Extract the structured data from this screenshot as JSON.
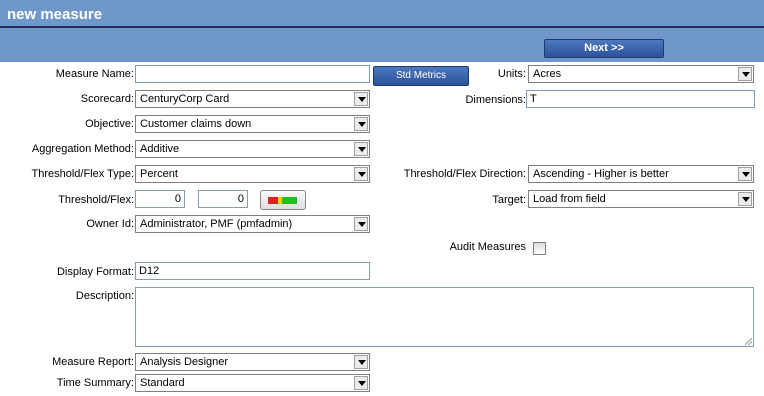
{
  "header": {
    "title": "new measure"
  },
  "toolbar": {
    "next_label": "Next >>"
  },
  "form": {
    "measure_name": {
      "label": "Measure Name:",
      "value": ""
    },
    "std_metrics_label": "Std Metrics",
    "units": {
      "label": "Units:",
      "value": "Acres"
    },
    "scorecard": {
      "label": "Scorecard:",
      "value": "CenturyCorp Card"
    },
    "dimensions": {
      "label": "Dimensions:",
      "value": "T"
    },
    "objective": {
      "label": "Objective:",
      "value": "Customer claims down"
    },
    "aggregation_method": {
      "label": "Aggregation Method:",
      "value": "Additive"
    },
    "threshold_flex_type": {
      "label": "Threshold/Flex Type:",
      "value": "Percent"
    },
    "threshold_flex_direction": {
      "label": "Threshold/Flex Direction:",
      "value": "Ascending - Higher is better"
    },
    "threshold_flex": {
      "label": "Threshold/Flex:",
      "value1": "0",
      "value2": "0"
    },
    "target": {
      "label": "Target:",
      "value": "Load from field"
    },
    "owner_id": {
      "label": "Owner Id:",
      "value": "Administrator, PMF (pmfadmin)"
    },
    "audit_measures": {
      "label": "Audit Measures",
      "checked": false
    },
    "display_format": {
      "label": "Display Format:",
      "value": "D12"
    },
    "description": {
      "label": "Description:",
      "value": ""
    },
    "measure_report": {
      "label": "Measure Report:",
      "value": "Analysis Designer"
    },
    "time_summary": {
      "label": "Time Summary:",
      "value": "Standard"
    }
  },
  "colors": {
    "header_bg": "#6f98c9",
    "header_rule": "#1c2e55",
    "button_bg": "#2c529a",
    "flex_red": "#e02020",
    "flex_yellow": "#e8d800",
    "flex_green": "#20c020"
  },
  "icons": {
    "threshold_flex_button": "red-yellow-green-bar-icon",
    "dropdown": "chevron-down-icon"
  }
}
